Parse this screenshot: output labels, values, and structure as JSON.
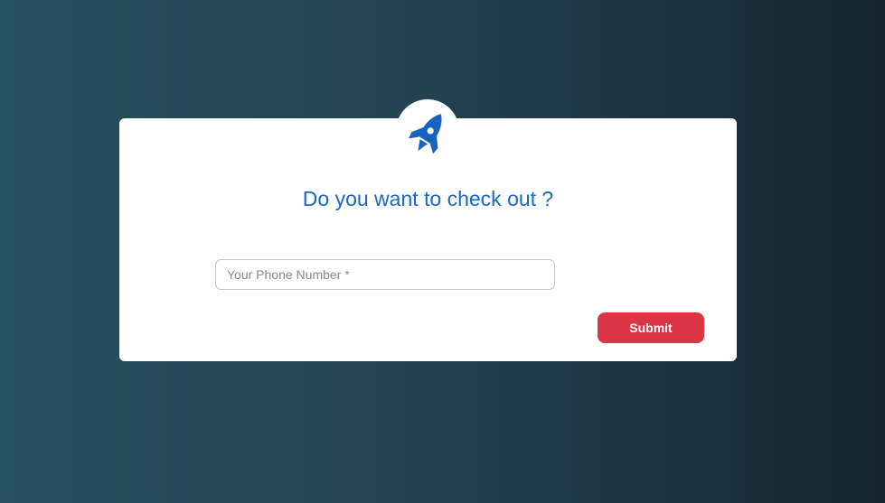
{
  "dialog": {
    "logo_icon": "rocket-icon",
    "title": "Do you want to check out ?",
    "phone_placeholder": "Your Phone Number *",
    "phone_value": "",
    "submit_label": "Submit"
  },
  "colors": {
    "background_left": "#264f60",
    "background_right": "#15262f",
    "title": "#1769c2",
    "icon": "#1565c0",
    "submit": "#dc3545"
  }
}
